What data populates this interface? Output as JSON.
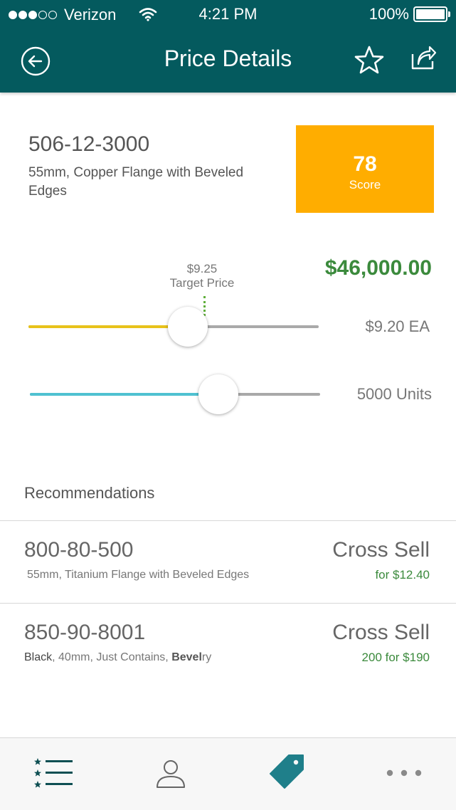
{
  "status_bar": {
    "carrier": "Verizon",
    "time": "4:21 PM",
    "battery": "100%"
  },
  "nav": {
    "title": "Price Details",
    "back_icon": "back-arrow-icon",
    "favorite_icon": "star-icon",
    "share_icon": "share-icon"
  },
  "product": {
    "id": "506-12-3000",
    "description": "55mm, Copper Flange with Beveled Edges",
    "score_value": "78",
    "score_label": "Score",
    "total_price": "$46,000.00"
  },
  "price_slider": {
    "target_value": "$9.25",
    "target_label": "Target Price",
    "readout": "$9.20 EA",
    "level": 0.55
  },
  "units_slider": {
    "readout": "5000 Units",
    "level": 0.65
  },
  "recommendations": {
    "title": "Recommendations",
    "items": [
      {
        "id": "800-80-500",
        "description": "55mm, Titanium Flange with Beveled Edges",
        "type": "Cross Sell",
        "offer": "for $12.40"
      },
      {
        "id": "850-90-8001",
        "description_parts": [
          "Black",
          ", 40mm, Just Contains, ",
          "Bevel",
          "ry"
        ],
        "type": "Cross Sell",
        "offer": "200 for $190"
      }
    ]
  },
  "tabbar": {
    "tabs": [
      "list-icon",
      "profile-icon",
      "price-tag-icon",
      "more-icon"
    ],
    "active": "price-tag-icon"
  },
  "colors": {
    "header": "#045a5e",
    "score": "#ffad00",
    "price_green": "#3b8a3c",
    "price_track": "#e8c21a",
    "units_track": "#4fc1d1",
    "tab_active": "#1f7f8a"
  }
}
